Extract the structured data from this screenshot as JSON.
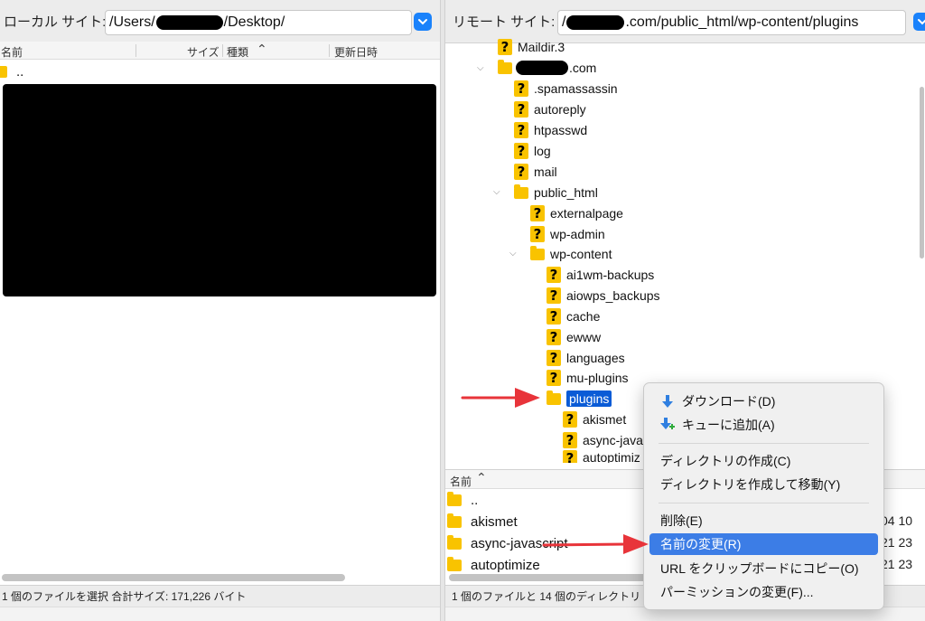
{
  "local": {
    "site_label": "ローカル サイト:",
    "path_prefix": "/Users/",
    "path_suffix": "/Desktop/",
    "columns": {
      "name": "名前",
      "size": "サイズ",
      "type": "種類",
      "modified": "更新日時"
    },
    "parent_entry": "..",
    "status": "1 個のファイルを選択 合計サイズ: 171,226 バイト"
  },
  "remote": {
    "site_label": "リモート サイト:",
    "path_prefix": "/",
    "path_suffix": ".com/public_html/wp-content/plugins",
    "tree": {
      "maildir3": "Maildir.3",
      "domain_suffix": ".com",
      "spamassassin": ".spamassassin",
      "autoreply": "autoreply",
      "htpasswd": "htpasswd",
      "log": "log",
      "mail": "mail",
      "public_html": "public_html",
      "externalpage": "externalpage",
      "wp_admin": "wp-admin",
      "wp_content": "wp-content",
      "ai1wm": "ai1wm-backups",
      "aiowps": "aiowps_backups",
      "cache": "cache",
      "ewww": "ewww",
      "languages": "languages",
      "mu_plugins": "mu-plugins",
      "plugins": "plugins",
      "akismet": "akismet",
      "async_java": "async-java",
      "autoptimize": "autoptimiz"
    },
    "list_header": {
      "name": "名前"
    },
    "list": {
      "parent": "..",
      "akismet": "akismet",
      "async": "async-javascript",
      "autoptimize": "autoptimize",
      "date1": "04 10",
      "date2": "21 23",
      "date3": "21 23"
    },
    "status": "1 個のファイルと 14 個のディレクトリ"
  },
  "context_menu": {
    "download": "ダウンロード(D)",
    "queue_add": "キューに追加(A)",
    "mkdir": "ディレクトリの作成(C)",
    "mkdir_enter": "ディレクトリを作成して移動(Y)",
    "delete": "削除(E)",
    "rename": "名前の変更(R)",
    "copy_url": "URL をクリップボードにコピー(O)",
    "permissions": "パーミッションの変更(F)..."
  },
  "colors": {
    "accent": "#1a82fb",
    "selection": "#0a5bd6",
    "menu_highlight": "#3c7de6",
    "folder": "#f9c300",
    "annotation_arrow": "#e8343a"
  },
  "icons": {
    "dropdown": "chevron-down-icon",
    "folder": "folder-icon",
    "unknown": "question-icon",
    "download": "download-arrow-icon",
    "queue": "queue-add-icon",
    "sort": "chevron-up-icon"
  }
}
